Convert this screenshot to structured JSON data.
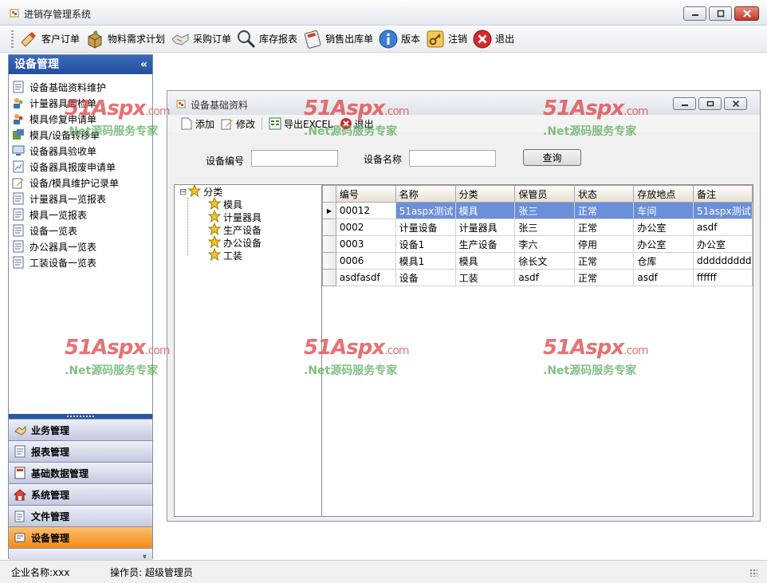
{
  "window": {
    "title": "进销存管理系统"
  },
  "toolbar": {
    "items": [
      {
        "label": "客户订单",
        "icon": "hand-pen-icon"
      },
      {
        "label": "物料需求计划",
        "icon": "box-icon"
      },
      {
        "label": "采购订单",
        "icon": "handshake-icon"
      },
      {
        "label": "库存报表",
        "icon": "magnifier-icon"
      },
      {
        "label": "销售出库单",
        "icon": "calculator-icon"
      },
      {
        "label": "版本",
        "icon": "info-icon"
      },
      {
        "label": "注销",
        "icon": "key-icon"
      },
      {
        "label": "退出",
        "icon": "close-icon"
      }
    ]
  },
  "sidebar": {
    "title": "设备管理",
    "collapse_glyph": "«",
    "expand_glyph": "»",
    "items": [
      "设备基础资料维护",
      "计量器具周检单",
      "模具修复申请单",
      "模具/设备转移单",
      "设备器具验收单",
      "设备器具报废申请单",
      "设备/模具维护记录单",
      "计量器具一览报表",
      "模具一览报表",
      "设备一览表",
      "办公器具一览表",
      "工装设备一览表"
    ],
    "groups": [
      {
        "label": "业务管理",
        "active": false
      },
      {
        "label": "报表管理",
        "active": false
      },
      {
        "label": "基础数据管理",
        "active": false
      },
      {
        "label": "系统管理",
        "active": false
      },
      {
        "label": "文件管理",
        "active": false
      },
      {
        "label": "设备管理",
        "active": true
      }
    ]
  },
  "child_window": {
    "title": "设备基础资料",
    "toolbar": {
      "add": "添加",
      "edit": "修改",
      "export": "导出EXCEL",
      "exit": "退出"
    },
    "search": {
      "code_label": "设备编号",
      "name_label": "设备名称",
      "query_button": "查询",
      "code_value": "",
      "name_value": ""
    },
    "tree": {
      "root": "分类",
      "children": [
        "模具",
        "计量器具",
        "生产设备",
        "办公设备",
        "工装"
      ],
      "expander": "⊟"
    },
    "grid": {
      "columns": [
        "编号",
        "名称",
        "分类",
        "保管员",
        "状态",
        "存放地点",
        "备注"
      ],
      "rows": [
        [
          "00012",
          "51aspx测试",
          "模具",
          "张三",
          "正常",
          "车间",
          "51aspx测试"
        ],
        [
          "0002",
          "计量设备",
          "计量器具",
          "张三",
          "正常",
          "办公室",
          "asdf"
        ],
        [
          "0003",
          "设备1",
          "生产设备",
          "李六",
          "停用",
          "办公室",
          "办公室"
        ],
        [
          "0006",
          "模具1",
          "模具",
          "徐长文",
          "正常",
          "仓库",
          "ddddddddd"
        ],
        [
          "asdfasdf",
          "设备",
          "工装",
          "asdf",
          "正常",
          "asdf",
          "ffffff"
        ]
      ],
      "selected_row": 0
    }
  },
  "status": {
    "company": "企业名称:xxx",
    "operator": "操作员: 超级管理员"
  },
  "watermark": {
    "brand": "51Aspx",
    "domain": ".com",
    "slogan": ".Net源码服务专家"
  },
  "colors": {
    "sidebar_header": "#2250a0",
    "active_group": "#f58a17",
    "grid_selection": "#6b8fd8"
  }
}
